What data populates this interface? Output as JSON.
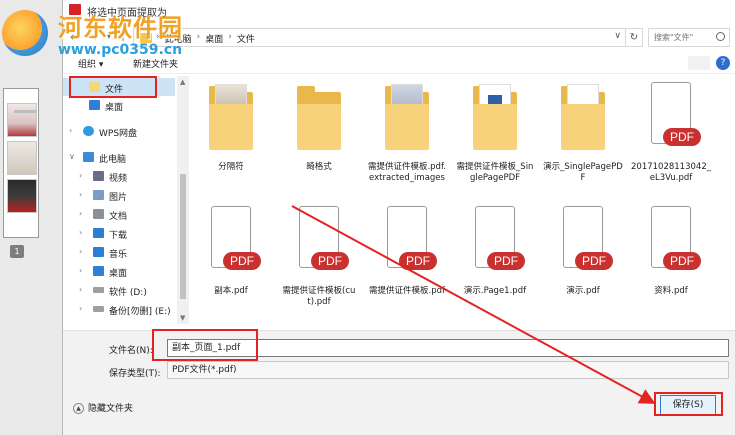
{
  "watermark": {
    "title": "河东软件园",
    "url": "www.pc0359.cn"
  },
  "background_app": {
    "page_number": "1"
  },
  "dialog": {
    "title": "将选中页面提取为"
  },
  "address": {
    "crumbs": [
      "此电脑",
      "桌面",
      "文件"
    ],
    "search_placeholder": "搜索\"文件\""
  },
  "toolbar": {
    "organize": "组织 ▾",
    "new_folder": "新建文件夹"
  },
  "nav": {
    "items": [
      {
        "label": "文件",
        "icon": "folder-icon"
      },
      {
        "label": "桌面",
        "icon": "desktop-icon"
      },
      {
        "label": "WPS网盘",
        "icon": "cloud-icon"
      },
      {
        "label": "此电脑",
        "icon": "computer-icon"
      },
      {
        "label": "视频",
        "icon": "video-icon"
      },
      {
        "label": "图片",
        "icon": "picture-icon"
      },
      {
        "label": "文档",
        "icon": "document-icon"
      },
      {
        "label": "下载",
        "icon": "download-icon"
      },
      {
        "label": "音乐",
        "icon": "music-icon"
      },
      {
        "label": "桌面",
        "icon": "desktop-icon"
      },
      {
        "label": "软件 (D:)",
        "icon": "drive-icon"
      },
      {
        "label": "备份[勿删] (E:)",
        "icon": "drive-icon"
      }
    ]
  },
  "files": [
    {
      "name": "分隔符",
      "kind": "folder"
    },
    {
      "name": "畸格式",
      "kind": "folder"
    },
    {
      "name": "需提供证件模板.pdf.extracted_images",
      "kind": "folder"
    },
    {
      "name": "需提供证件模板_SinglePagePDF",
      "kind": "folder"
    },
    {
      "name": "演示_SinglePagePDF",
      "kind": "folder"
    },
    {
      "name": "20171028113042_eL3Vu.pdf",
      "kind": "pdf"
    },
    {
      "name": "副本.pdf",
      "kind": "pdf"
    },
    {
      "name": "需提供证件模板(cut).pdf",
      "kind": "pdf"
    },
    {
      "name": "需提供证件模板.pdf",
      "kind": "pdf"
    },
    {
      "name": "演示.Page1.pdf",
      "kind": "pdf"
    },
    {
      "name": "演示.pdf",
      "kind": "pdf"
    },
    {
      "name": "资料.pdf",
      "kind": "pdf"
    }
  ],
  "pdf_badge": "PDF",
  "form": {
    "filename_label": "文件名(N):",
    "filename_value": "副本_页面_1.pdf",
    "filetype_label": "保存类型(T):",
    "filetype_value": "PDF文件(*.pdf)",
    "hide_folders": "隐藏文件夹",
    "save_button": "保存(S)"
  },
  "colors": {
    "annotation_red": "#e32222",
    "accent_blue": "#2f79cf",
    "pdf_red": "#c8312f"
  }
}
